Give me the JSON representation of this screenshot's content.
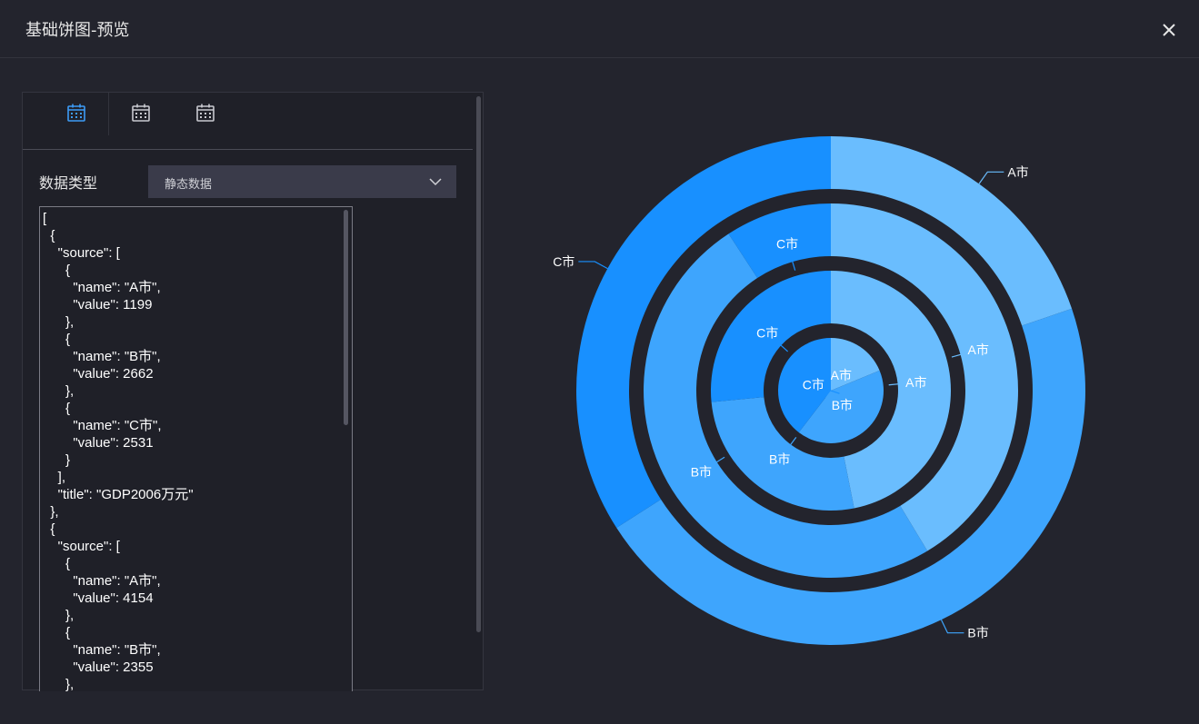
{
  "window": {
    "title": "基础饼图-预览"
  },
  "panel": {
    "tabs": [
      {
        "icon": "calendar-icon",
        "active": true
      },
      {
        "icon": "calendar-icon",
        "active": false
      },
      {
        "icon": "calendar-icon",
        "active": false
      }
    ],
    "data_type_label": "数据类型",
    "data_type_value": "静态数据",
    "code_lines": [
      "[",
      "  {",
      "    \"source\": [",
      "      {",
      "        \"name\": \"A市\",",
      "        \"value\": 1199",
      "      },",
      "      {",
      "        \"name\": \"B市\",",
      "        \"value\": 2662",
      "      },",
      "      {",
      "        \"name\": \"C市\",",
      "        \"value\": 2531",
      "      }",
      "    ],",
      "    \"title\": \"GDP2006万元\"",
      "  },",
      "  {",
      "    \"source\": [",
      "      {",
      "        \"name\": \"A市\",",
      "        \"value\": 4154",
      "      },",
      "      {",
      "        \"name\": \"B市\",",
      "        \"value\": 2355",
      "      },"
    ]
  },
  "colors": {
    "A": "#6abdfe",
    "B": "#3ea5fd",
    "C": "#1890ff",
    "accent": "#3d9bf5"
  },
  "chart_data": {
    "type": "pie",
    "rings": [
      {
        "slices": [
          {
            "name": "A市",
            "value": 1199
          },
          {
            "name": "B市",
            "value": 2662
          },
          {
            "name": "C市",
            "value": 2531
          }
        ]
      },
      {
        "slices": [
          {
            "name": "A市",
            "value": 4154
          },
          {
            "name": "B市",
            "value": 2355
          },
          {
            "name": "C市",
            "value": 2350
          }
        ]
      },
      {
        "slices": [
          {
            "name": "A市",
            "value": 3600
          },
          {
            "name": "B市",
            "value": 4300
          },
          {
            "name": "C市",
            "value": 800
          }
        ]
      },
      {
        "slices": [
          {
            "name": "A市",
            "value": 1800
          },
          {
            "name": "B市",
            "value": 4200
          },
          {
            "name": "C市",
            "value": 3100
          }
        ]
      }
    ]
  }
}
